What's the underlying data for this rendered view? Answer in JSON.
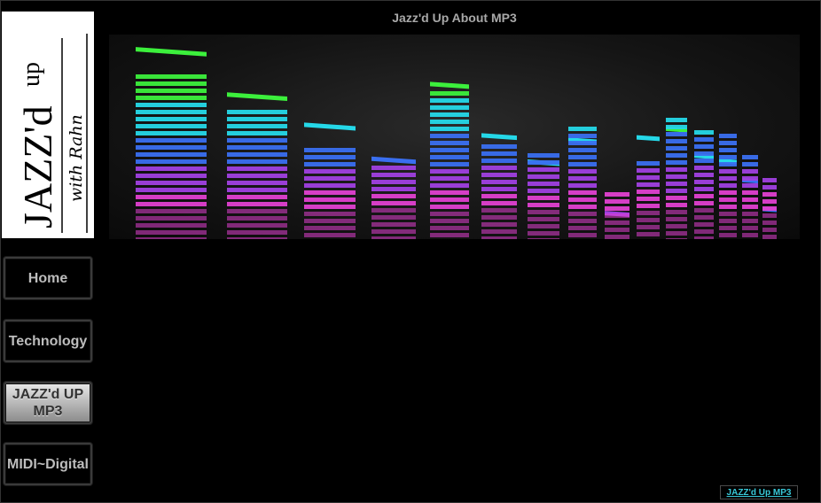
{
  "page": {
    "title": "Jazz'd Up About MP3"
  },
  "logo": {
    "main_text": "JAZZ'd",
    "superscript": "up",
    "tagline": "with Rahn"
  },
  "nav": {
    "items": [
      {
        "label": "Home",
        "active": false
      },
      {
        "label": "Technology",
        "active": false
      },
      {
        "label": "JAZZ'd UP MP3",
        "active": true
      },
      {
        "label": "MIDI~Digital",
        "active": false
      }
    ]
  },
  "footer": {
    "link_label": "JAZZ'd Up MP3"
  },
  "banner": {
    "icon": "equalizer-graphic",
    "colors": {
      "green": "#3cf03c",
      "cyan": "#25d8e8",
      "blue": "#3a6ff0",
      "purple": "#a040e0",
      "magenta": "#e040d0"
    }
  }
}
